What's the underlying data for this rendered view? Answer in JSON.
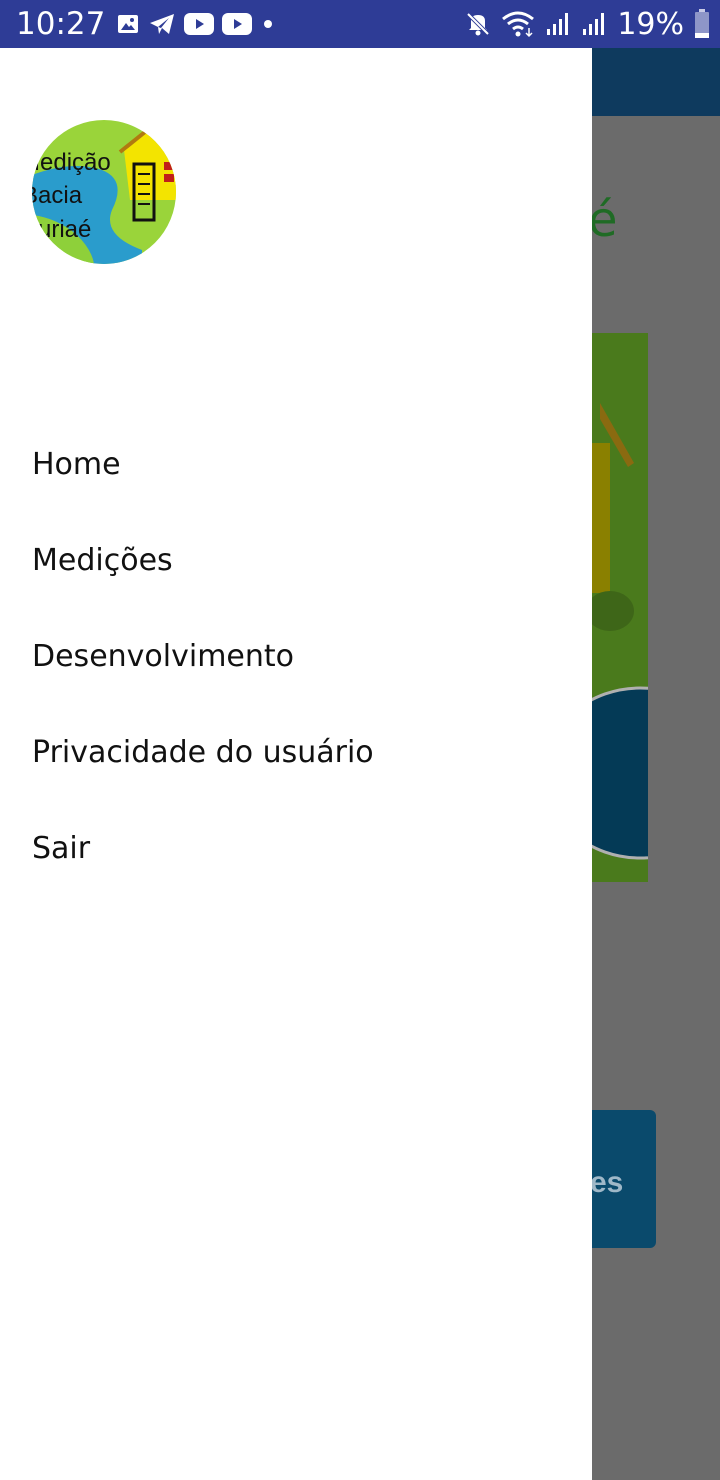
{
  "status_bar": {
    "time": "10:27",
    "battery": "19%",
    "icons_left": [
      "image-icon",
      "telegram-icon",
      "youtube-icon",
      "youtube-icon",
      "dot-icon"
    ],
    "icons_right": [
      "mute-icon",
      "wifi-icon",
      "signal-icon",
      "signal-icon",
      "battery-icon"
    ]
  },
  "drawer": {
    "logo_text": [
      "Medição",
      "Bacia",
      "Muriaé"
    ],
    "menu": [
      {
        "label": "Home"
      },
      {
        "label": "Medições"
      },
      {
        "label": "Desenvolvimento"
      },
      {
        "label": "Privacidade do usuário"
      },
      {
        "label": "Sair"
      }
    ]
  },
  "background_app": {
    "title_fragment": "é",
    "button_fragment": "es"
  },
  "colors": {
    "status_bar": "#2e3c96",
    "scrim": "#6b6b6b",
    "drawer": "#ffffff",
    "toolbar": "#0e3a5e"
  }
}
